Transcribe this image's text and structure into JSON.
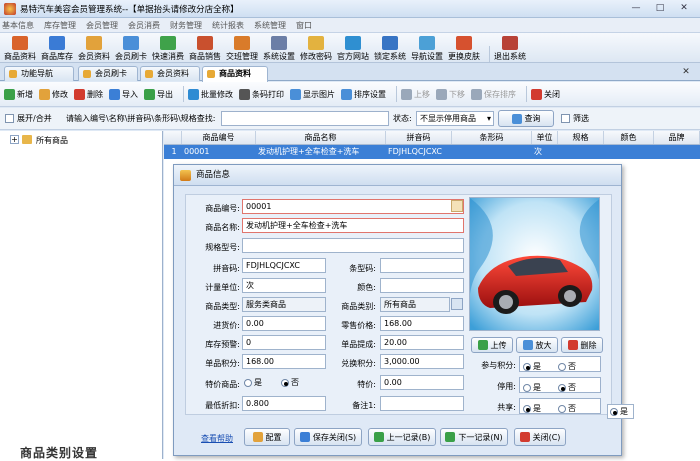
{
  "window": {
    "title": "易特汽车美容会员管理系统--【单据抬头请修改分店全称】",
    "min": "—",
    "max": "□",
    "close": "✕"
  },
  "menu": [
    "基本信息",
    "库存管理",
    "会员管理",
    "会员消费",
    "财务管理",
    "统计报表",
    "系统管理",
    "窗口"
  ],
  "toolbar": [
    {
      "label": "商品资料",
      "color": "#d9632b"
    },
    {
      "label": "商品库存",
      "color": "#3a7bd5"
    },
    {
      "label": "会员资料",
      "color": "#e2a23b"
    },
    {
      "label": "会员刷卡",
      "color": "#4a8fd8"
    },
    {
      "label": "快速消费",
      "color": "#3fa24a"
    },
    {
      "label": "商品销售",
      "color": "#c9502e"
    },
    {
      "label": "交班管理",
      "color": "#d97b2a"
    },
    {
      "label": "系统设置",
      "color": "#6b7ea6"
    },
    {
      "label": "修改密码",
      "color": "#e3b23f"
    },
    {
      "label": "官方网站",
      "color": "#2f8fd1"
    },
    {
      "label": "锁定系统",
      "color": "#3774c4"
    },
    {
      "label": "导航设置",
      "color": "#4ca0d6"
    },
    {
      "label": "更换皮肤",
      "color": "#d6512f"
    },
    {
      "label": "退出系统",
      "color": "#b84237"
    }
  ],
  "tabs": [
    {
      "label": "功能导航"
    },
    {
      "label": "会员刷卡"
    },
    {
      "label": "会员资料"
    },
    {
      "label": "商品资料"
    }
  ],
  "actions": [
    {
      "label": "新增",
      "color": "#3aa048",
      "enabled": true
    },
    {
      "label": "修改",
      "color": "#e2a23b",
      "enabled": true
    },
    {
      "label": "删除",
      "color": "#d23b2f",
      "enabled": true
    },
    {
      "label": "导入",
      "color": "#3b7fd6",
      "enabled": true
    },
    {
      "label": "导出",
      "color": "#3aa048",
      "enabled": true
    },
    {
      "label": "批量修改",
      "color": "#2e8bd3",
      "enabled": true
    },
    {
      "label": "条码打印",
      "color": "#555555",
      "enabled": true
    },
    {
      "label": "显示图片",
      "color": "#4a8fd8",
      "enabled": true
    },
    {
      "label": "排序设置",
      "color": "#4a8fd8",
      "enabled": true
    },
    {
      "label": "上移",
      "color": "#9aa8ba",
      "enabled": false
    },
    {
      "label": "下移",
      "color": "#9aa8ba",
      "enabled": false
    },
    {
      "label": "保存排序",
      "color": "#9aa8ba",
      "enabled": false
    },
    {
      "label": "关闭",
      "color": "#d23b2f",
      "enabled": true
    }
  ],
  "search": {
    "expand_label": "展开/合并",
    "hint": "请输入编号\\名称\\拼音码\\条形码\\规格查找:",
    "status_label": "状态:",
    "status_value": "不显示停用商品",
    "query_btn": "查询",
    "filter_label": "筛选"
  },
  "tree": {
    "root": "所有商品",
    "bottom_label": "商品类别设置"
  },
  "grid": {
    "columns": [
      "",
      "商品编号",
      "商品名称",
      "拼音码",
      "条形码",
      "单位",
      "规格",
      "颜色",
      "品牌"
    ],
    "rows": [
      [
        "1",
        "00001",
        "发动机护理+全车检查+洗车",
        "FDJHLQCJCXC",
        "",
        "次",
        "",
        "",
        ""
      ]
    ]
  },
  "dialog": {
    "title": "商品信息",
    "fields": {
      "code": {
        "label": "商品编号:",
        "value": "00001"
      },
      "name": {
        "label": "商品名称:",
        "value": "发动机护理+全车检查+洗车"
      },
      "spec": {
        "label": "规格型号:",
        "value": ""
      },
      "pinyin": {
        "label": "拼音码:",
        "value": "FDJHLQCJCXC"
      },
      "barcode": {
        "label": "条型码:",
        "value": ""
      },
      "unit": {
        "label": "计量单位:",
        "value": "次"
      },
      "color": {
        "label": "颜色:",
        "value": ""
      },
      "type": {
        "label": "商品类型:",
        "value": "服务类商品"
      },
      "category": {
        "label": "商品类别:",
        "value": "所有商品"
      },
      "cost": {
        "label": "进货价:",
        "value": "0.00"
      },
      "retail": {
        "label": "零售价格:",
        "value": "168.00"
      },
      "alert": {
        "label": "库存预警:",
        "value": "0"
      },
      "commission": {
        "label": "单品提成:",
        "value": "20.00"
      },
      "points": {
        "label": "单品积分:",
        "value": "168.00"
      },
      "redeem": {
        "label": "兑换积分:",
        "value": "3,000.00"
      },
      "special": {
        "label": "特价商品:"
      },
      "special_price": {
        "label": "特价:",
        "value": "0.00"
      },
      "min_discount": {
        "label": "最低折扣:",
        "value": "0.800"
      },
      "note": {
        "label": "备注1:",
        "value": ""
      }
    },
    "radios": {
      "join_points": {
        "label": "参与积分:",
        "yes": "是",
        "no": "否",
        "selected": "yes"
      },
      "disabled": {
        "label": "停用:",
        "yes": "是",
        "no": "否",
        "selected": "no"
      },
      "shared": {
        "label": "共享:",
        "yes": "是",
        "no": "否",
        "selected": "yes"
      },
      "special": {
        "yes": "是",
        "no": "否",
        "selected": "no"
      }
    },
    "photo_buttons": {
      "upload": "上传",
      "zoom": "放大",
      "delete": "删除"
    },
    "footer": {
      "help": "查看帮助",
      "config": "配置",
      "save_close": "保存关闭(S)",
      "prev": "上一记录(B)",
      "next": "下一记录(N)",
      "close": "关闭(C)"
    },
    "ghost_radio_yes": "是"
  }
}
